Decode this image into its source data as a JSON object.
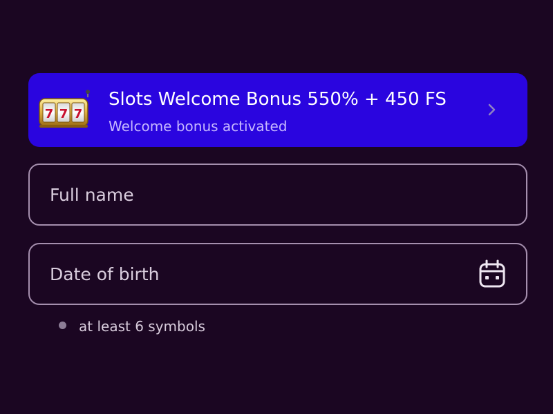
{
  "bonus": {
    "title": "Slots Welcome Bonus 550% + 450 FS",
    "subtitle": "Welcome bonus activated",
    "icon": "slot-machine-icon",
    "background_color": "#2a05df"
  },
  "form": {
    "full_name": {
      "value": "",
      "placeholder": "Full name"
    },
    "date_of_birth": {
      "value": "",
      "placeholder": "Date of birth",
      "icon": "calendar-icon"
    }
  },
  "hint": {
    "text": "at least 6 symbols"
  }
}
